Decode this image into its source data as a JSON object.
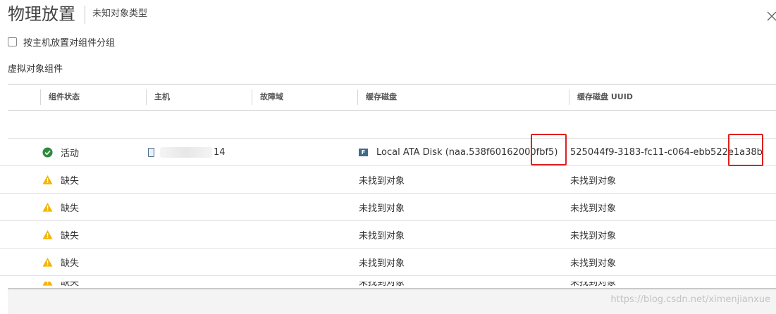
{
  "header": {
    "title": "物理放置",
    "subtitle": "未知对象类型",
    "close_icon": "close-icon"
  },
  "grouping": {
    "checkbox_checked": false,
    "label": "按主机放置对组件分组"
  },
  "section_title": "虚拟对象组件",
  "table": {
    "columns": [
      "组件状态",
      "主机",
      "故障域",
      "缓存磁盘",
      "缓存磁盘 UUID"
    ],
    "rows": [
      {
        "status_icon": "check-circle-icon",
        "status": "活动",
        "host_icon": "host-icon",
        "host_suffix": "14",
        "fault_domain": "",
        "cache_disk_icon_letter": "F",
        "cache_disk": "Local ATA Disk (naa.538f60162000fbf5)",
        "uuid": "525044f9-3183-fc11-c064-ebb522e1a38b"
      },
      {
        "status_icon": "warning-icon",
        "status": "缺失",
        "cache_disk": "未找到对象",
        "uuid": "未找到对象"
      },
      {
        "status_icon": "warning-icon",
        "status": "缺失",
        "cache_disk": "未找到对象",
        "uuid": "未找到对象"
      },
      {
        "status_icon": "warning-icon",
        "status": "缺失",
        "cache_disk": "未找到对象",
        "uuid": "未找到对象"
      },
      {
        "status_icon": "warning-icon",
        "status": "缺失",
        "cache_disk": "未找到对象",
        "uuid": "未找到对象"
      },
      {
        "status_icon": "warning-icon",
        "status": "缺失",
        "cache_disk": "未找到对象",
        "uuid": "未找到对象"
      }
    ]
  },
  "colors": {
    "success": "#2e8b3d",
    "warning": "#f4b400",
    "highlight": "#e02020"
  },
  "watermark": "https://blog.csdn.net/ximenjianxue"
}
